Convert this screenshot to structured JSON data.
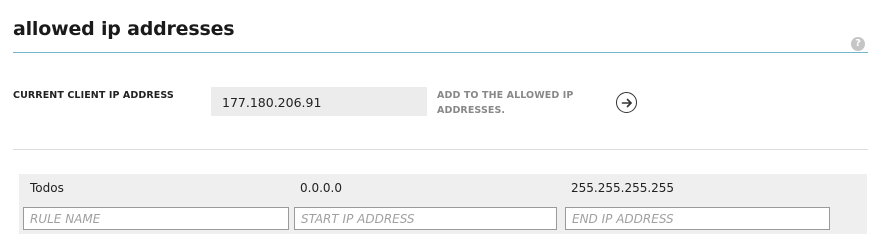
{
  "header": {
    "title": "allowed ip addresses",
    "help_icon": "help-icon"
  },
  "client": {
    "label": "CURRENT CLIENT IP ADDRESS",
    "ip_value": "177.180.206.91",
    "add_label_line1": "ADD TO THE ALLOWED IP",
    "add_label_line2": "ADDRESSES.",
    "arrow_icon": "arrow-right-circle-icon"
  },
  "rules": {
    "rows": [
      {
        "rule_name": "Todos",
        "start_ip": "0.0.0.0",
        "end_ip": "255.255.255.255"
      }
    ],
    "new_rule": {
      "rule_name_placeholder": "RULE NAME",
      "start_ip_placeholder": "START IP ADDRESS",
      "end_ip_placeholder": "END IP ADDRESS"
    }
  },
  "colors": {
    "accent_underline": "#6fb6c8",
    "table_background": "#efefef",
    "link_gray": "#888888"
  }
}
